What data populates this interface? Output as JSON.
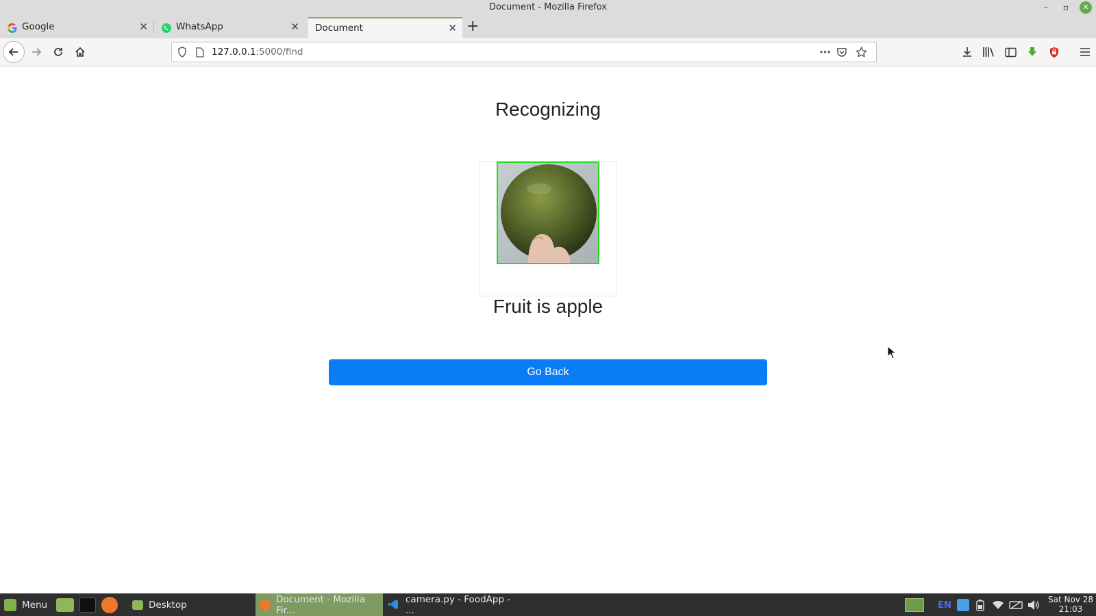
{
  "window": {
    "title": "Document - Mozilla Firefox",
    "controls": {
      "minimize": "–",
      "maximize": "▫",
      "close": "✕"
    }
  },
  "tabs": [
    {
      "label": "Google",
      "icon": "google-icon",
      "active": false
    },
    {
      "label": "WhatsApp",
      "icon": "whatsapp-icon",
      "active": false
    },
    {
      "label": "Document",
      "icon": "",
      "active": true
    }
  ],
  "tab_close_glyph": "✕",
  "new_tab_glyph": "+",
  "nav": {
    "url_host": "127.0.0.1",
    "url_path": ":5000/find",
    "more_glyph": "•••"
  },
  "page": {
    "heading": "Recognizing",
    "result": "Fruit is apple",
    "go_back_label": "Go Back",
    "image_border_color": "#22dd22"
  },
  "taskbar": {
    "menu_label": "Menu",
    "items": [
      {
        "label": "Desktop",
        "active": false
      },
      {
        "label": "Document - Mozilla Fir...",
        "active": true
      },
      {
        "label": "camera.py - FoodApp - ...",
        "active": false
      }
    ],
    "language": "EN",
    "clock_date": "Sat Nov 28",
    "clock_time": "21:03"
  },
  "colors": {
    "accent_button": "#0a7cf6",
    "taskbar_bg": "#2f2f2f",
    "taskbar_active": "#7f9a63"
  }
}
